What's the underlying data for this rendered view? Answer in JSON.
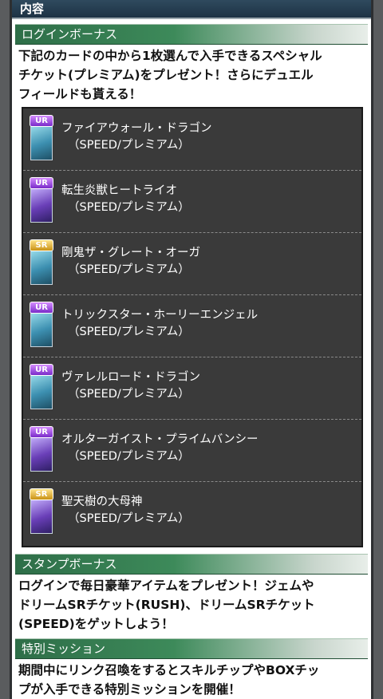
{
  "header": {
    "title": "内容"
  },
  "login_bonus": {
    "heading": "ログインボーナス",
    "description": "下記のカードの中から1枚選んで入手できるスペシャル\nチケット(プレミアム)をプレゼント！さらにデュエル\nフィールドも貰える！",
    "cards": [
      {
        "rarity": "UR",
        "name": "ファイアウォール・ドラゴン",
        "sub": "（SPEED/プレミアム）",
        "art_color": "cyan"
      },
      {
        "rarity": "UR",
        "name": "転生炎獣ヒートライオ",
        "sub": "（SPEED/プレミアム）",
        "art_color": "purple"
      },
      {
        "rarity": "SR",
        "name": "剛鬼ザ・グレート・オーガ",
        "sub": "（SPEED/プレミアム）",
        "art_color": "cyan"
      },
      {
        "rarity": "UR",
        "name": "トリックスター・ホーリーエンジェル",
        "sub": "（SPEED/プレミアム）",
        "art_color": "cyan"
      },
      {
        "rarity": "UR",
        "name": "ヴァレルロード・ドラゴン",
        "sub": "（SPEED/プレミアム）",
        "art_color": "cyan"
      },
      {
        "rarity": "UR",
        "name": "オルターガイスト・プライムバンシー",
        "sub": "（SPEED/プレミアム）",
        "art_color": "purple"
      },
      {
        "rarity": "SR",
        "name": "聖天樹の大母神",
        "sub": "（SPEED/プレミアム）",
        "art_color": "purple"
      }
    ]
  },
  "stamp_bonus": {
    "heading": "スタンプボーナス",
    "description": "ログインで毎日豪華アイテムをプレゼント！ジェムや\nドリームSRチケット(RUSH)、ドリームSRチケット\n(SPEED)をゲットしよう！"
  },
  "special_mission": {
    "heading": "特別ミッション",
    "description": "期間中にリンク召喚をするとスキルチップやBOXチッ\nプが入手できる特別ミッションを開催！"
  },
  "colors": {
    "section_green": "#3d8a5a",
    "card_panel": "#3a3a3a",
    "ur_badge": "#7a2bc9",
    "sr_badge": "#c99215"
  }
}
